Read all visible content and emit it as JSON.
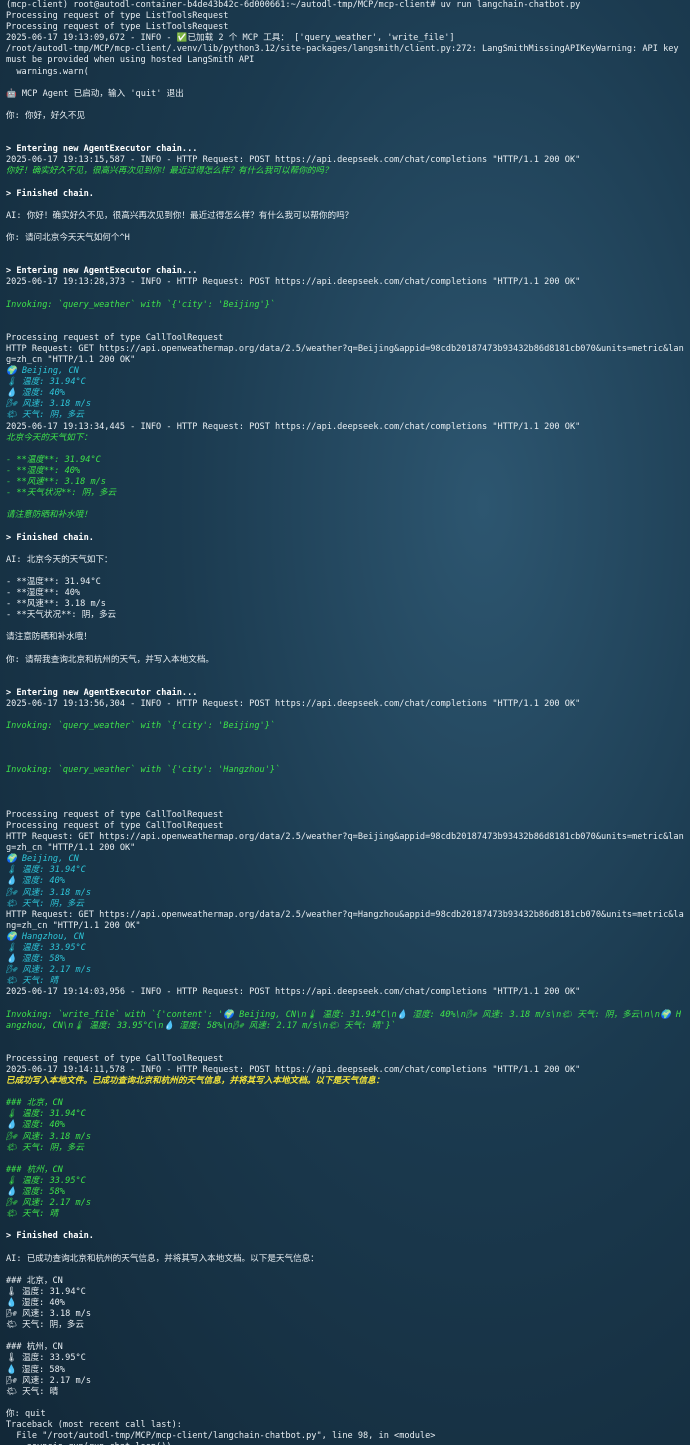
{
  "terminal": {
    "lines": [
      {
        "t": "(mcp-client) root@autodl-container-b4de43b42c-6d000661:~/autodl-tmp/MCP/mcp-client# uv run langchain-chatbot.py",
        "c": "white"
      },
      {
        "t": "Processing request of type ListToolsRequest",
        "c": "white"
      },
      {
        "t": "Processing request of type ListToolsRequest",
        "c": "white"
      },
      {
        "t": "2025-06-17 19:13:09,672 - INFO - ✅已加载 2 个 MCP 工具： ['query_weather', 'write_file']",
        "c": "white"
      },
      {
        "t": "/root/autodl-tmp/MCP/mcp-client/.venv/lib/python3.12/site-packages/langsmith/client.py:272: LangSmithMissingAPIKeyWarning: API key must be provided when using hosted LangSmith API",
        "c": "white"
      },
      {
        "t": "  warnings.warn(",
        "c": "white"
      },
      {
        "t": "",
        "c": "white"
      },
      {
        "t": "🤖 MCP Agent 已启动，输入 'quit' 退出",
        "c": "white"
      },
      {
        "t": "",
        "c": "white"
      },
      {
        "t": "你: 你好，好久不见",
        "c": "white"
      },
      {
        "t": "",
        "c": "white"
      },
      {
        "t": "",
        "c": "white"
      },
      {
        "t": "> Entering new AgentExecutor chain...",
        "c": "bold"
      },
      {
        "t": "2025-06-17 19:13:15,587 - INFO - HTTP Request: POST https://api.deepseek.com/chat/completions \"HTTP/1.1 200 OK\"",
        "c": "white"
      },
      {
        "t": "你好！确实好久不见，很高兴再次见到你！最近过得怎么样？有什么我可以帮你的吗？",
        "c": "green"
      },
      {
        "t": "",
        "c": "white"
      },
      {
        "t": "> Finished chain.",
        "c": "bold"
      },
      {
        "t": "",
        "c": "white"
      },
      {
        "t": "AI: 你好！确实好久不见，很高兴再次见到你！最近过得怎么样？有什么我可以帮你的吗？",
        "c": "white"
      },
      {
        "t": "",
        "c": "white"
      },
      {
        "t": "你: 请问北京今天天气如何个^H",
        "c": "white"
      },
      {
        "t": "",
        "c": "white"
      },
      {
        "t": "",
        "c": "white"
      },
      {
        "t": "> Entering new AgentExecutor chain...",
        "c": "bold"
      },
      {
        "t": "2025-06-17 19:13:28,373 - INFO - HTTP Request: POST https://api.deepseek.com/chat/completions \"HTTP/1.1 200 OK\"",
        "c": "white"
      },
      {
        "t": "",
        "c": "white"
      },
      {
        "t": "Invoking: `query_weather` with `{'city': 'Beijing'}`",
        "c": "green"
      },
      {
        "t": "",
        "c": "white"
      },
      {
        "t": "",
        "c": "white"
      },
      {
        "t": "Processing request of type CallToolRequest",
        "c": "white"
      },
      {
        "t": "HTTP Request: GET https://api.openweathermap.org/data/2.5/weather?q=Beijing&appid=98cdb20187473b93432b86d8181cb070&units=metric&lang=zh_cn \"HTTP/1.1 200 OK\"",
        "c": "white"
      },
      {
        "t": "🌍 Beijing, CN",
        "c": "cyan"
      },
      {
        "t": "🌡 温度: 31.94°C",
        "c": "cyan"
      },
      {
        "t": "💧 湿度: 40%",
        "c": "cyan"
      },
      {
        "t": "🌬 风速: 3.18 m/s",
        "c": "cyan"
      },
      {
        "t": "🌤 天气: 阴，多云",
        "c": "cyan"
      },
      {
        "t": "2025-06-17 19:13:34,445 - INFO - HTTP Request: POST https://api.deepseek.com/chat/completions \"HTTP/1.1 200 OK\"",
        "c": "white"
      },
      {
        "t": "北京今天的天气如下：",
        "c": "green"
      },
      {
        "t": "",
        "c": "white"
      },
      {
        "t": "- **温度**: 31.94°C",
        "c": "green"
      },
      {
        "t": "- **湿度**: 40%",
        "c": "green"
      },
      {
        "t": "- **风速**: 3.18 m/s",
        "c": "green"
      },
      {
        "t": "- **天气状况**: 阴，多云",
        "c": "green"
      },
      {
        "t": "",
        "c": "white"
      },
      {
        "t": "请注意防晒和补水哦！",
        "c": "green"
      },
      {
        "t": "",
        "c": "white"
      },
      {
        "t": "> Finished chain.",
        "c": "bold"
      },
      {
        "t": "",
        "c": "white"
      },
      {
        "t": "AI: 北京今天的天气如下：",
        "c": "white"
      },
      {
        "t": "",
        "c": "white"
      },
      {
        "t": "- **温度**: 31.94°C",
        "c": "white"
      },
      {
        "t": "- **湿度**: 40%",
        "c": "white"
      },
      {
        "t": "- **风速**: 3.18 m/s",
        "c": "white"
      },
      {
        "t": "- **天气状况**: 阴，多云",
        "c": "white"
      },
      {
        "t": "",
        "c": "white"
      },
      {
        "t": "请注意防晒和补水哦！",
        "c": "white"
      },
      {
        "t": "",
        "c": "white"
      },
      {
        "t": "你: 请帮我查询北京和杭州的天气，并写入本地文档。",
        "c": "white"
      },
      {
        "t": "",
        "c": "white"
      },
      {
        "t": "",
        "c": "white"
      },
      {
        "t": "> Entering new AgentExecutor chain...",
        "c": "bold"
      },
      {
        "t": "2025-06-17 19:13:56,304 - INFO - HTTP Request: POST https://api.deepseek.com/chat/completions \"HTTP/1.1 200 OK\"",
        "c": "white"
      },
      {
        "t": "",
        "c": "white"
      },
      {
        "t": "Invoking: `query_weather` with `{'city': 'Beijing'}`",
        "c": "green"
      },
      {
        "t": "",
        "c": "white"
      },
      {
        "t": "",
        "c": "white"
      },
      {
        "t": "",
        "c": "white"
      },
      {
        "t": "Invoking: `query_weather` with `{'city': 'Hangzhou'}`",
        "c": "green"
      },
      {
        "t": "",
        "c": "white"
      },
      {
        "t": "",
        "c": "white"
      },
      {
        "t": "",
        "c": "white"
      },
      {
        "t": "Processing request of type CallToolRequest",
        "c": "white"
      },
      {
        "t": "Processing request of type CallToolRequest",
        "c": "white"
      },
      {
        "t": "HTTP Request: GET https://api.openweathermap.org/data/2.5/weather?q=Beijing&appid=98cdb20187473b93432b86d8181cb070&units=metric&lang=zh_cn \"HTTP/1.1 200 OK\"",
        "c": "white"
      },
      {
        "t": "🌍 Beijing, CN",
        "c": "cyan"
      },
      {
        "t": "🌡 温度: 31.94°C",
        "c": "cyan"
      },
      {
        "t": "💧 湿度: 40%",
        "c": "cyan"
      },
      {
        "t": "🌬 风速: 3.18 m/s",
        "c": "cyan"
      },
      {
        "t": "🌤 天气: 阴，多云",
        "c": "cyan"
      },
      {
        "t": "HTTP Request: GET https://api.openweathermap.org/data/2.5/weather?q=Hangzhou&appid=98cdb20187473b93432b86d8181cb070&units=metric&lang=zh_cn \"HTTP/1.1 200 OK\"",
        "c": "white"
      },
      {
        "t": "🌍 Hangzhou, CN",
        "c": "cyan"
      },
      {
        "t": "🌡 温度: 33.95°C",
        "c": "cyan"
      },
      {
        "t": "💧 湿度: 58%",
        "c": "cyan"
      },
      {
        "t": "🌬 风速: 2.17 m/s",
        "c": "cyan"
      },
      {
        "t": "🌤 天气: 晴",
        "c": "cyan"
      },
      {
        "t": "2025-06-17 19:14:03,956 - INFO - HTTP Request: POST https://api.deepseek.com/chat/completions \"HTTP/1.1 200 OK\"",
        "c": "white"
      },
      {
        "t": "",
        "c": "white"
      },
      {
        "t": "Invoking: `write_file` with `{'content': '🌍 Beijing, CN\\n🌡 温度: 31.94°C\\n💧 湿度: 40%\\n🌬 风速: 3.18 m/s\\n🌤 天气: 阴，多云\\n\\n🌍 Hangzhou, CN\\n🌡 温度: 33.95°C\\n💧 湿度: 58%\\n🌬 风速: 2.17 m/s\\n🌤 天气: 晴'}`",
        "c": "green"
      },
      {
        "t": "",
        "c": "white"
      },
      {
        "t": "",
        "c": "white"
      },
      {
        "t": "Processing request of type CallToolRequest",
        "c": "white"
      },
      {
        "t": "2025-06-17 19:14:11,578 - INFO - HTTP Request: POST https://api.deepseek.com/chat/completions \"HTTP/1.1 200 OK\"",
        "c": "white"
      },
      {
        "t": "已成功写入本地文件。已成功查询北京和杭州的天气信息，并将其写入本地文档。以下是天气信息：",
        "c": "yellow"
      },
      {
        "t": "",
        "c": "white"
      },
      {
        "t": "### 北京，CN",
        "c": "green"
      },
      {
        "t": "🌡 温度: 31.94°C",
        "c": "green"
      },
      {
        "t": "💧 湿度: 40%",
        "c": "green"
      },
      {
        "t": "🌬 风速: 3.18 m/s",
        "c": "green"
      },
      {
        "t": "🌤 天气: 阴，多云",
        "c": "green"
      },
      {
        "t": "",
        "c": "white"
      },
      {
        "t": "### 杭州，CN",
        "c": "green"
      },
      {
        "t": "🌡 温度: 33.95°C",
        "c": "green"
      },
      {
        "t": "💧 湿度: 58%",
        "c": "green"
      },
      {
        "t": "🌬 风速: 2.17 m/s",
        "c": "green"
      },
      {
        "t": "🌤 天气: 晴",
        "c": "green"
      },
      {
        "t": "",
        "c": "white"
      },
      {
        "t": "> Finished chain.",
        "c": "bold"
      },
      {
        "t": "",
        "c": "white"
      },
      {
        "t": "AI: 已成功查询北京和杭州的天气信息，并将其写入本地文档。以下是天气信息：",
        "c": "white"
      },
      {
        "t": "",
        "c": "white"
      },
      {
        "t": "### 北京，CN",
        "c": "white"
      },
      {
        "t": "🌡 温度: 31.94°C",
        "c": "white"
      },
      {
        "t": "💧 湿度: 40%",
        "c": "white"
      },
      {
        "t": "🌬 风速: 3.18 m/s",
        "c": "white"
      },
      {
        "t": "🌤 天气: 阴，多云",
        "c": "white"
      },
      {
        "t": "",
        "c": "white"
      },
      {
        "t": "### 杭州，CN",
        "c": "white"
      },
      {
        "t": "🌡 温度: 33.95°C",
        "c": "white"
      },
      {
        "t": "💧 湿度: 58%",
        "c": "white"
      },
      {
        "t": "🌬 风速: 2.17 m/s",
        "c": "white"
      },
      {
        "t": "🌤 天气: 晴",
        "c": "white"
      },
      {
        "t": "",
        "c": "white"
      },
      {
        "t": "你: quit",
        "c": "white"
      },
      {
        "t": "Traceback (most recent call last):",
        "c": "white"
      },
      {
        "t": "  File \"/root/autodl-tmp/MCP/mcp-client/langchain-chatbot.py\", line 98, in <module>",
        "c": "white"
      },
      {
        "t": "    asyncio.run(run_chat_loop())",
        "c": "white"
      }
    ]
  }
}
